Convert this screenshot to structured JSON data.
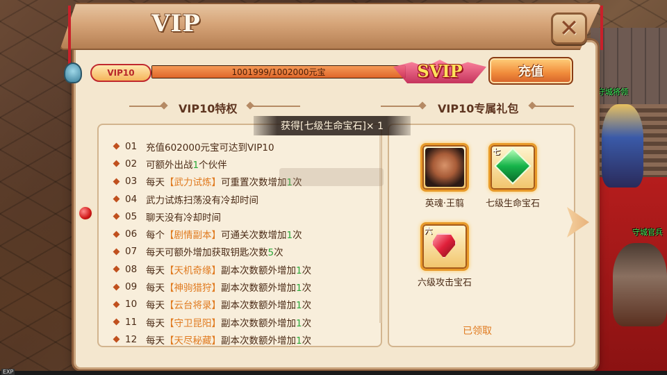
{
  "title": "VIP",
  "close_icon": "close-x",
  "progress": {
    "vip_level": "VIP10",
    "text": "1001999/1002000元宝",
    "fraction": 0.999999,
    "svip_label": "SVIP"
  },
  "recharge_label": "充值",
  "privileges_header": "VIP10特权",
  "gifts_header": "VIP10专属礼包",
  "toast": "获得[七级生命宝石]× 1",
  "privileges": [
    {
      "num": "01",
      "parts": [
        {
          "t": "充值602000元宝可达到VIP10",
          "c": ""
        }
      ]
    },
    {
      "num": "02",
      "parts": [
        {
          "t": "可额外出战",
          "c": ""
        },
        {
          "t": "1",
          "c": "g"
        },
        {
          "t": "个伙伴",
          "c": ""
        }
      ]
    },
    {
      "num": "03",
      "parts": [
        {
          "t": "每天",
          "c": ""
        },
        {
          "t": "【武力试炼】",
          "c": "o"
        },
        {
          "t": "可重置次数增加",
          "c": ""
        },
        {
          "t": "1",
          "c": "g"
        },
        {
          "t": "次",
          "c": ""
        }
      ]
    },
    {
      "num": "04",
      "parts": [
        {
          "t": "武力试炼扫荡没有冷却时间",
          "c": ""
        }
      ]
    },
    {
      "num": "05",
      "parts": [
        {
          "t": "聊天没有冷却时间",
          "c": ""
        }
      ]
    },
    {
      "num": "06",
      "parts": [
        {
          "t": "每个",
          "c": ""
        },
        {
          "t": "【剧情副本】",
          "c": "o"
        },
        {
          "t": "可通关次数增加",
          "c": ""
        },
        {
          "t": "1",
          "c": "g"
        },
        {
          "t": "次",
          "c": ""
        }
      ]
    },
    {
      "num": "07",
      "parts": [
        {
          "t": "每天可额外增加获取钥匙次数",
          "c": ""
        },
        {
          "t": "5",
          "c": "g"
        },
        {
          "t": "次",
          "c": ""
        }
      ]
    },
    {
      "num": "08",
      "parts": [
        {
          "t": "每天",
          "c": ""
        },
        {
          "t": "【天机奇缘】",
          "c": "o"
        },
        {
          "t": "副本次数额外增加",
          "c": ""
        },
        {
          "t": "1",
          "c": "g"
        },
        {
          "t": "次",
          "c": ""
        }
      ]
    },
    {
      "num": "09",
      "parts": [
        {
          "t": "每天",
          "c": ""
        },
        {
          "t": "【神驹猎狩】",
          "c": "o"
        },
        {
          "t": "副本次数额外增加",
          "c": ""
        },
        {
          "t": "1",
          "c": "g"
        },
        {
          "t": "次",
          "c": ""
        }
      ]
    },
    {
      "num": "10",
      "parts": [
        {
          "t": "每天",
          "c": ""
        },
        {
          "t": "【云台将录】",
          "c": "o"
        },
        {
          "t": "副本次数额外增加",
          "c": ""
        },
        {
          "t": "1",
          "c": "g"
        },
        {
          "t": "次",
          "c": ""
        }
      ]
    },
    {
      "num": "11",
      "parts": [
        {
          "t": "每天",
          "c": ""
        },
        {
          "t": "【守卫昆阳】",
          "c": "o"
        },
        {
          "t": "副本次数额外增加",
          "c": ""
        },
        {
          "t": "1",
          "c": "g"
        },
        {
          "t": "次",
          "c": ""
        }
      ]
    },
    {
      "num": "12",
      "parts": [
        {
          "t": "每天",
          "c": ""
        },
        {
          "t": "【天尽秘藏】",
          "c": "o"
        },
        {
          "t": "副本次数额外增加",
          "c": ""
        },
        {
          "t": "1",
          "c": "g"
        },
        {
          "t": "次",
          "c": ""
        }
      ]
    }
  ],
  "gifts": [
    {
      "name": "英魂·王翦",
      "icon": "hero-portrait",
      "tag": ""
    },
    {
      "name": "七级生命宝石",
      "icon": "green-gem",
      "tag": "七"
    },
    {
      "name": "六级攻击宝石",
      "icon": "red-gem",
      "tag": "六"
    }
  ],
  "claimed_label": "已领取",
  "npc_labels": [
    "守城将领",
    "守城官兵"
  ],
  "npc_top_label": "兵",
  "exp_tag": "EXP",
  "colors": {
    "highlight_orange": "#e07a1f",
    "highlight_green": "#2aa838",
    "text_brown": "#4a2a15"
  }
}
